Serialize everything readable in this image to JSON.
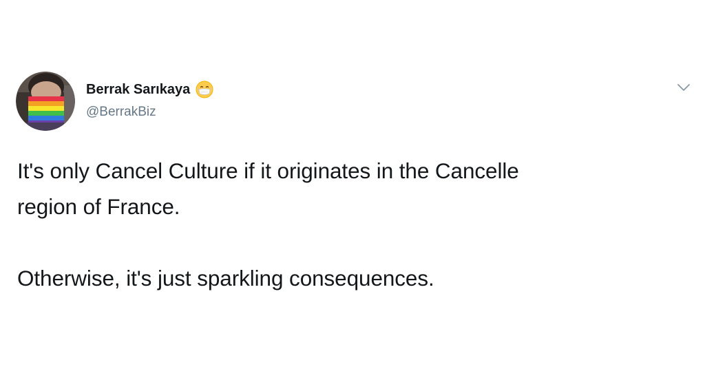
{
  "author": {
    "display_name": "Berrak Sarıkaya",
    "handle": "@BerrakBiz",
    "name_emoji": "face-with-medical-mask-emoji"
  },
  "tweet": {
    "line1": "It's only Cancel Culture if it originates in the Cancelle",
    "line2": "region of France.",
    "line3": "Otherwise, it's just sparkling consequences."
  },
  "menu": {
    "icon": "chevron-down-icon"
  },
  "colors": {
    "text": "#14171a",
    "secondary": "#657786",
    "background": "#ffffff"
  }
}
